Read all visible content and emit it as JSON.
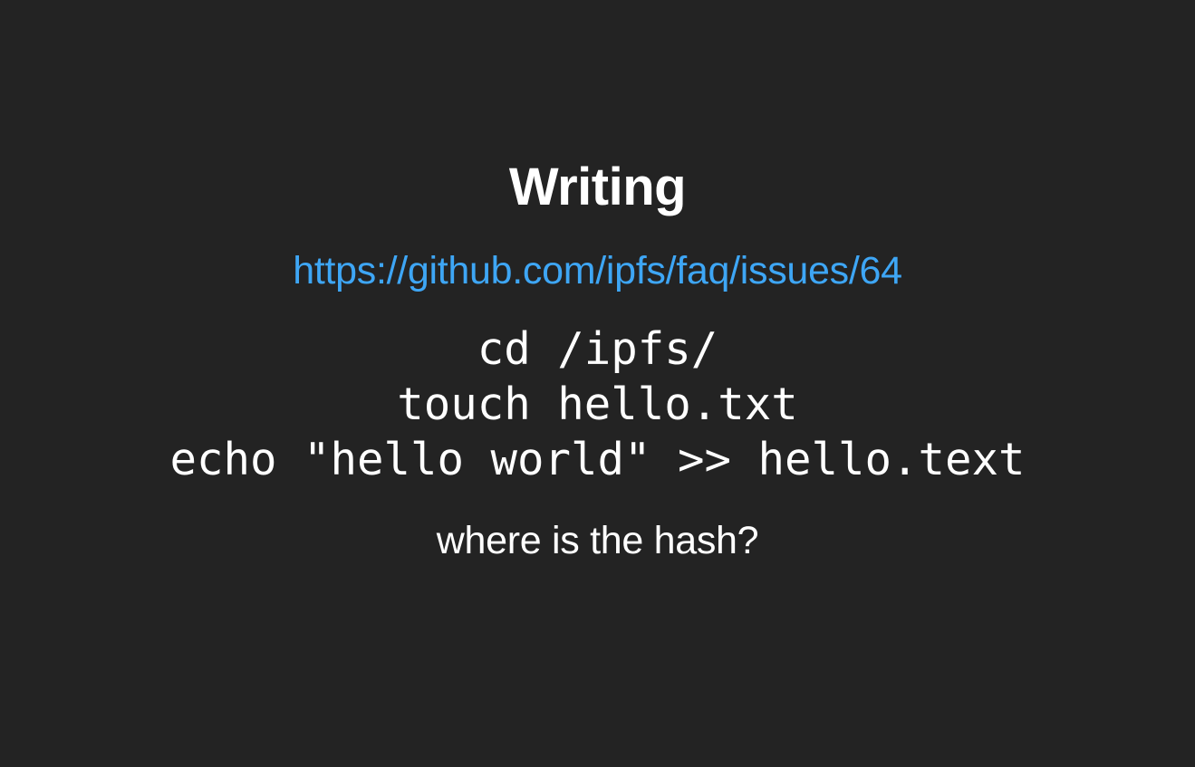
{
  "slide": {
    "title": "Writing",
    "link": "https://github.com/ipfs/faq/issues/64",
    "code_lines": [
      "cd /ipfs/",
      "touch hello.txt",
      "echo \"hello world\" >> hello.text"
    ],
    "question": "where is the hash?"
  },
  "colors": {
    "background": "#232323",
    "text": "#ffffff",
    "link": "#3ea6f5"
  }
}
